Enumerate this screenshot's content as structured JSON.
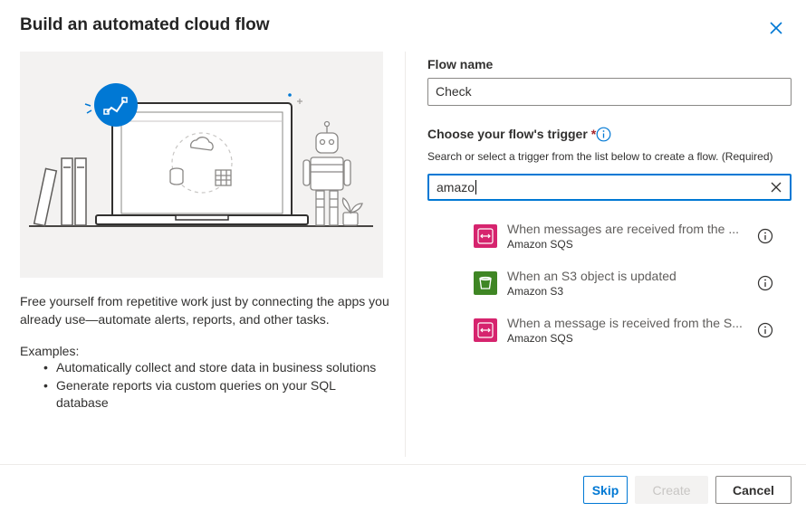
{
  "dialog": {
    "title": "Build an automated cloud flow"
  },
  "left": {
    "description": "Free yourself from repetitive work just by connecting the apps you already use—automate alerts, reports, and other tasks.",
    "examples_label": "Examples:",
    "examples": [
      "Automatically collect and store data in business solutions",
      "Generate reports via custom queries on your SQL database"
    ]
  },
  "form": {
    "flow_name_label": "Flow name",
    "flow_name_value": "Check",
    "trigger_label": "Choose your flow's trigger",
    "required_marker": "*",
    "trigger_help": "Search or select a trigger from the list below to create a flow. (Required)",
    "search_value": "amazo"
  },
  "results": [
    {
      "title": "When messages are received from the ...",
      "connector": "Amazon SQS",
      "icon": "amazon-sqs-icon",
      "color": "#d6246e"
    },
    {
      "title": "When an S3 object is updated",
      "connector": "Amazon S3",
      "icon": "amazon-s3-icon",
      "color": "#3f8624"
    },
    {
      "title": "When a message is received from the S...",
      "connector": "Amazon SQS",
      "icon": "amazon-sqs-icon",
      "color": "#d6246e"
    }
  ],
  "footer": {
    "skip_label": "Skip",
    "create_label": "Create",
    "cancel_label": "Cancel"
  },
  "colors": {
    "accent": "#0078d4",
    "required": "#a4262c",
    "sqs": "#d6246e",
    "s3": "#3f8624"
  }
}
